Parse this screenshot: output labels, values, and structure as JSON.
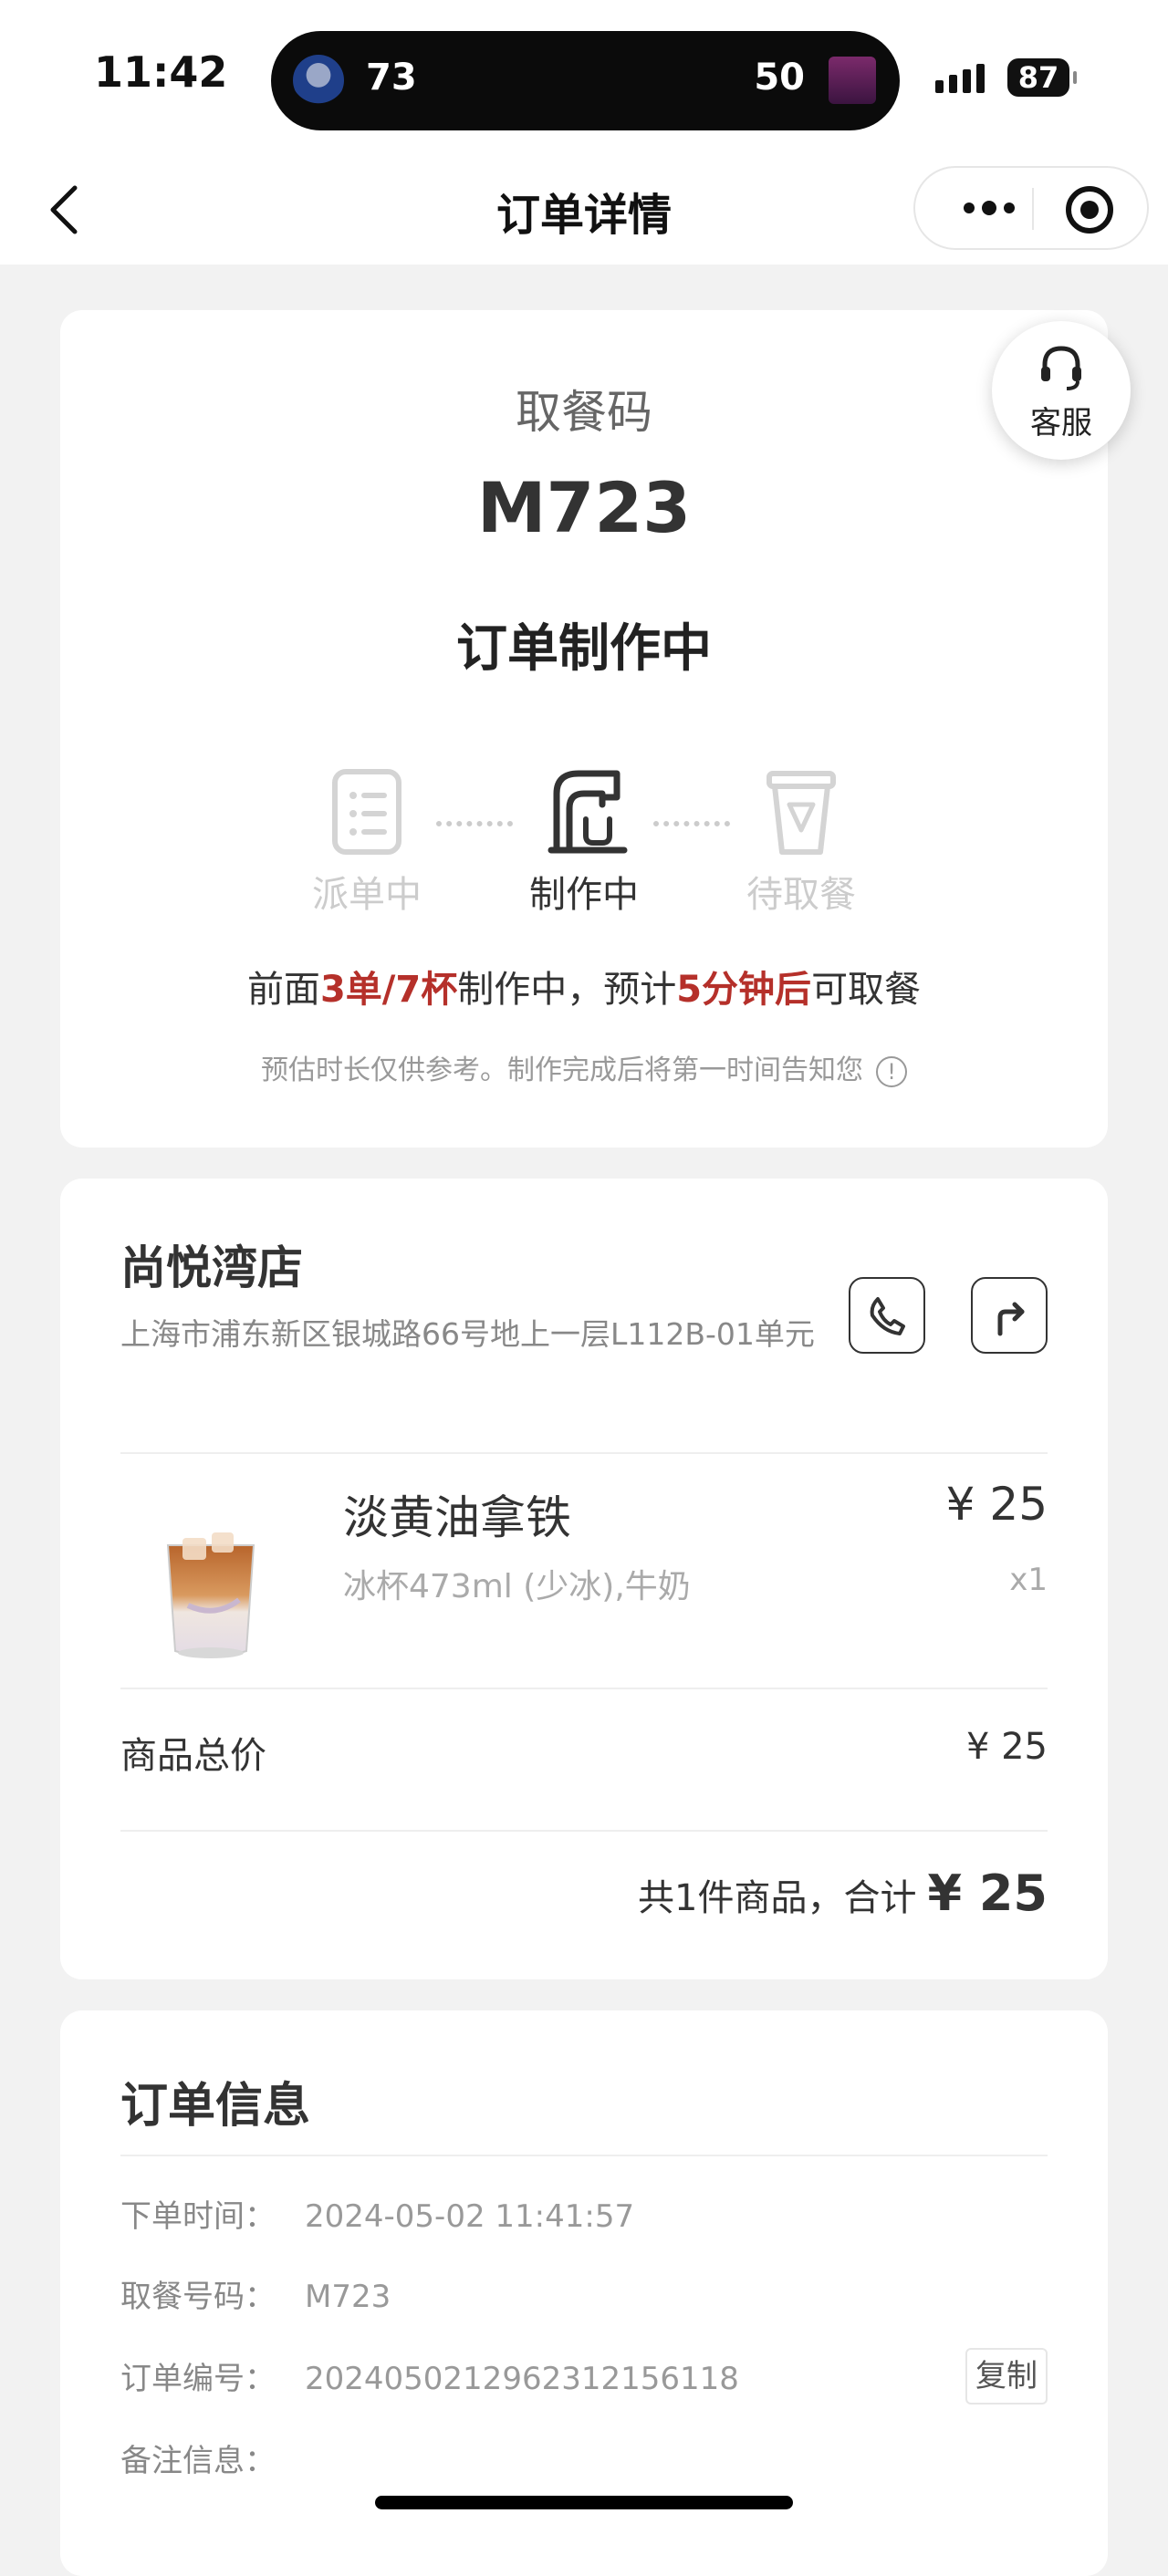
{
  "status_bar": {
    "time": "11:42",
    "live_activity": {
      "score_left": "73",
      "score_right": "50"
    },
    "battery": "87"
  },
  "nav": {
    "title": "订单详情"
  },
  "customer_service": {
    "label": "客服"
  },
  "pickup": {
    "label": "取餐码",
    "code": "M723",
    "status": "订单制作中",
    "steps": [
      {
        "label": "派单中",
        "state": "done"
      },
      {
        "label": "制作中",
        "state": "active"
      },
      {
        "label": "待取餐",
        "state": "pending"
      }
    ],
    "queue": {
      "prefix": "前面",
      "count": "3单/7杯",
      "middle": "制作中，预计",
      "eta": "5分钟后",
      "suffix": "可取餐"
    },
    "note": "预估时长仅供参考。制作完成后将第一时间告知您",
    "info_icon": "!"
  },
  "store": {
    "name": "尚悦湾店",
    "address": "上海市浦东新区银城路66号地上一层L112B-01单元",
    "icons": [
      "phone-icon",
      "navigation-icon"
    ]
  },
  "items": [
    {
      "name": "淡黄油拿铁",
      "spec": "冰杯473ml (少冰),牛奶",
      "price": "¥ 25",
      "qty": "x1"
    }
  ],
  "summary": {
    "subtotal_label": "商品总价",
    "subtotal_value": "¥ 25",
    "total_prefix": "共1件商品，合计",
    "total_value": "¥ 25"
  },
  "order_info": {
    "title": "订单信息",
    "rows": [
      {
        "key": "下单时间：",
        "value": "2024-05-02 11:41:57"
      },
      {
        "key": "取餐号码：",
        "value": "M723"
      },
      {
        "key": "订单编号：",
        "value": "20240502129623121561​18"
      },
      {
        "key": "备注信息：",
        "value": ""
      }
    ],
    "copy_label": "复制"
  },
  "colors": {
    "accent_red": "#b5302a",
    "background": "#f2f2f2"
  }
}
